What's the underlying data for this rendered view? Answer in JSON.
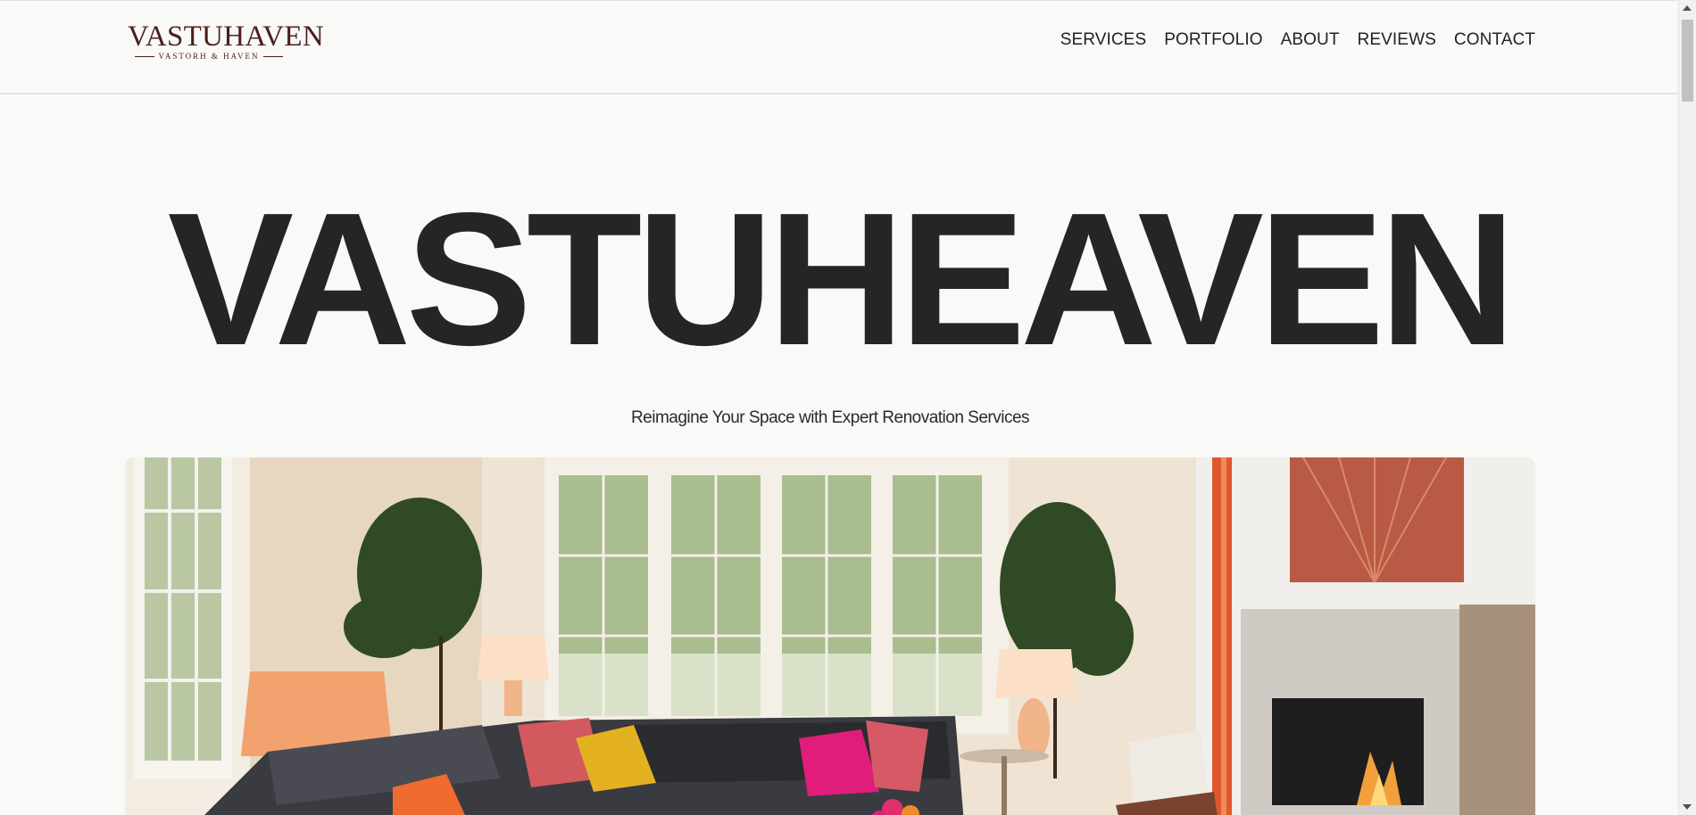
{
  "logo": {
    "wordmark": "VASTUHAVEN",
    "subline": "VASTORH & HAVEN",
    "colors": {
      "brand": "#4a1f1c"
    }
  },
  "nav": {
    "items": [
      {
        "label": "SERVICES"
      },
      {
        "label": "PORTFOLIO"
      },
      {
        "label": "ABOUT"
      },
      {
        "label": "REVIEWS"
      },
      {
        "label": "CONTACT"
      }
    ]
  },
  "hero": {
    "title": "VASTUHEAVEN",
    "tagline": "Reimagine Your Space with Expert Renovation Services",
    "image_icon": "living-room-photo"
  },
  "colors": {
    "background": "#f9f9f7",
    "heading": "#252525",
    "text": "#222222"
  }
}
